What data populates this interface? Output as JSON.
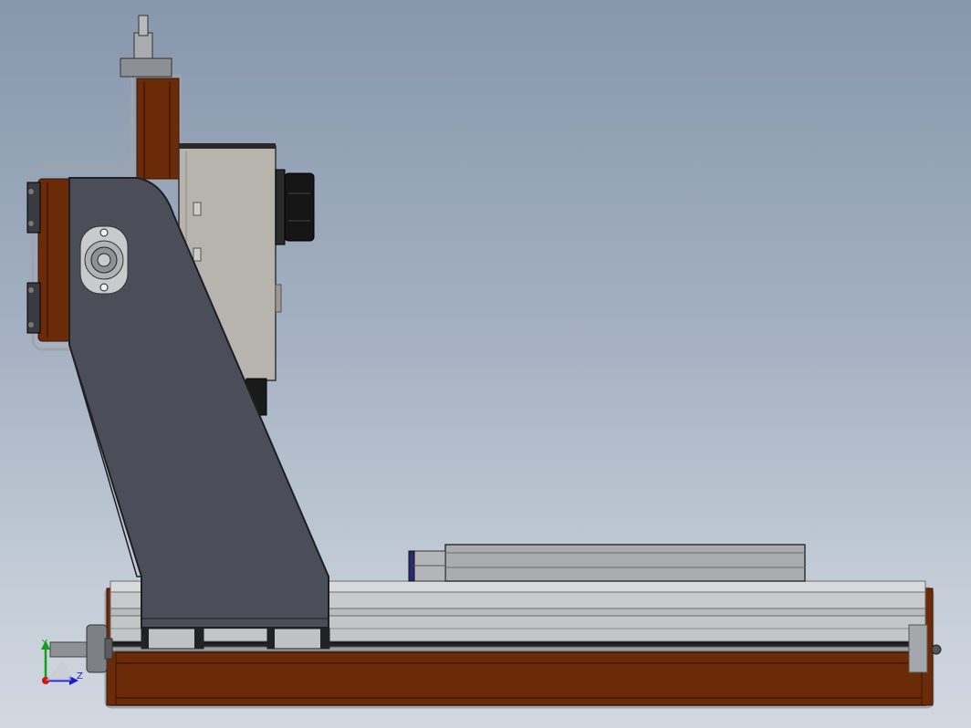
{
  "viewport": {
    "background_top": "#8797ac",
    "background_bottom": "#d2d8e0"
  },
  "colors": {
    "wood": "#6b2a08",
    "wood_edge": "#3a1503",
    "frame_dark": "#4b4e58",
    "frame_dark_edge": "#1e1f24",
    "aluminium": "#b9bcbf",
    "aluminium_light": "#d9dadb",
    "motor_housing": "#b7b4ae",
    "black": "#151515"
  },
  "triad": {
    "labels": {
      "y": "Y",
      "z": "Z"
    },
    "colors": {
      "x": "#d01414",
      "y": "#10a020",
      "z": "#1a1ad8"
    }
  }
}
